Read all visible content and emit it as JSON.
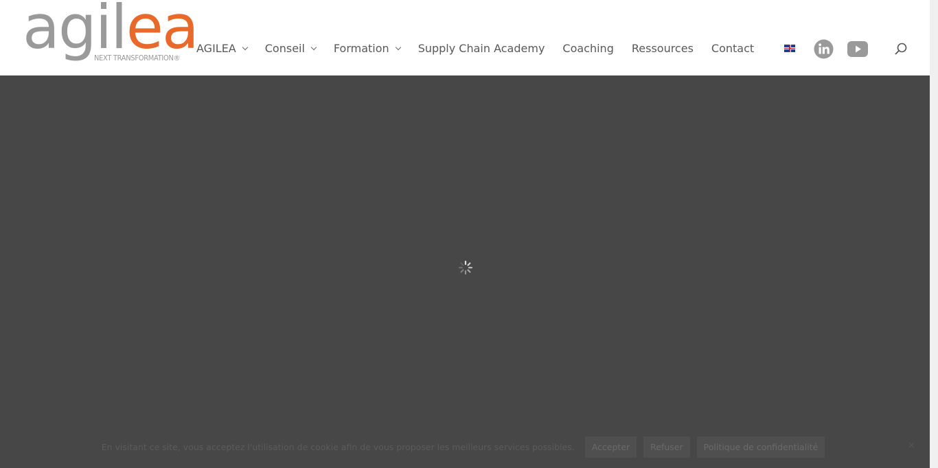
{
  "logo": {
    "word_gray": "agil",
    "word_orange": "ea",
    "tagline": "NEXT TRANSFORMATION®"
  },
  "nav": {
    "items": [
      {
        "label": "AGILEA",
        "has_submenu": true
      },
      {
        "label": "Conseil",
        "has_submenu": true
      },
      {
        "label": "Formation",
        "has_submenu": true
      },
      {
        "label": "Supply Chain Academy",
        "has_submenu": false
      },
      {
        "label": "Coaching",
        "has_submenu": false
      },
      {
        "label": "Ressources",
        "has_submenu": false
      },
      {
        "label": "Contact",
        "has_submenu": false
      }
    ]
  },
  "icons": {
    "flag": "uk-flag-icon",
    "linkedin": "linkedin-icon",
    "youtube": "youtube-icon",
    "search": "search-icon",
    "spinner": "loading-spinner-icon"
  },
  "cookie": {
    "text": "En visitant ce site, vous acceptez l'utilisation de cookie afin de vous proposer les meilleurs services possibles.",
    "accept_label": "Accepter",
    "refuse_label": "Refuser",
    "policy_label": "Politique de confidentialité",
    "close_label": "×"
  },
  "colors": {
    "brand_orange": "#e8692a",
    "brand_gray": "#9a9a9a",
    "overlay": "#474747"
  }
}
